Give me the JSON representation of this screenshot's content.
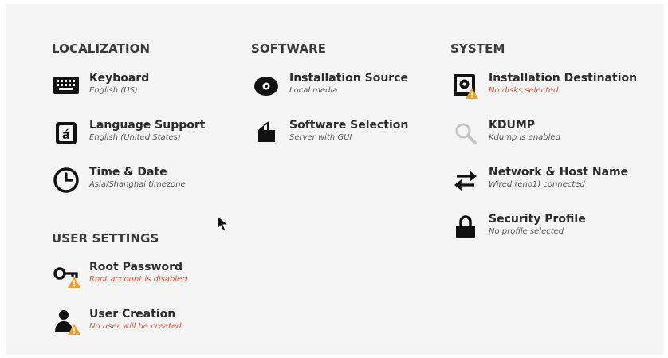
{
  "sections": {
    "localization": "LOCALIZATION",
    "software": "SOFTWARE",
    "system": "SYSTEM",
    "user_settings": "USER SETTINGS"
  },
  "spokes": {
    "keyboard": {
      "title": "Keyboard",
      "status": "English (US)",
      "icon": "keyboard-icon"
    },
    "language": {
      "title": "Language Support",
      "status": "English (United States)",
      "icon": "language-icon"
    },
    "time_date": {
      "title": "Time & Date",
      "status": "Asia/Shanghai timezone",
      "icon": "clock-icon"
    },
    "install_source": {
      "title": "Installation Source",
      "status": "Local media",
      "icon": "disc-icon"
    },
    "software_selection": {
      "title": "Software Selection",
      "status": "Server with GUI",
      "icon": "package-icon"
    },
    "install_dest": {
      "title": "Installation Destination",
      "status": "No disks selected",
      "icon": "harddisk-warning-icon"
    },
    "kdump": {
      "title": "KDUMP",
      "status": "Kdump is enabled",
      "icon": "magnifier-icon"
    },
    "network": {
      "title": "Network & Host Name",
      "status": "Wired (eno1) connected",
      "icon": "network-arrows-icon"
    },
    "security": {
      "title": "Security Profile",
      "status": "No profile selected",
      "icon": "lock-icon"
    },
    "root_password": {
      "title": "Root Password",
      "status": "Root account is disabled",
      "icon": "key-warning-icon"
    },
    "user_creation": {
      "title": "User Creation",
      "status": "No user will be created",
      "icon": "user-warning-icon"
    }
  },
  "colors": {
    "warning_text": "#e2543b",
    "warning_icon": "#f0a030",
    "background": "#f5f5f5"
  }
}
